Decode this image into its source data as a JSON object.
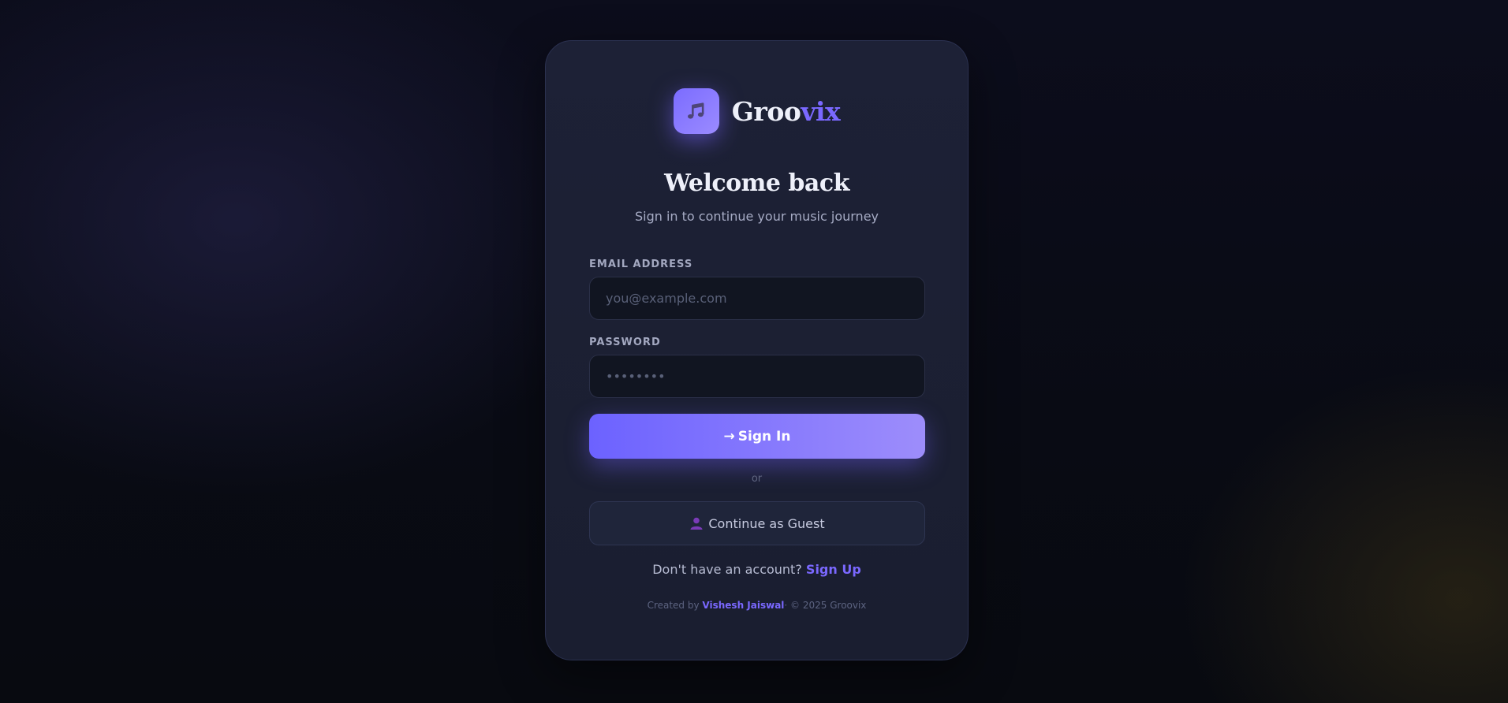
{
  "brand": {
    "name_main": "Groo",
    "name_accent": "vix",
    "logo_icon": "music-note-icon"
  },
  "heading": {
    "title": "Welcome back",
    "subtitle": "Sign in to continue your music journey"
  },
  "form": {
    "email": {
      "label": "EMAIL ADDRESS",
      "placeholder": "you@example.com",
      "value": ""
    },
    "password": {
      "label": "PASSWORD",
      "placeholder": "••••••••",
      "value": ""
    },
    "sign_in": {
      "icon": "→",
      "label": "Sign In"
    },
    "divider": "or",
    "guest": {
      "icon": "user-icon",
      "label": "Continue as Guest"
    }
  },
  "signup": {
    "prompt": "Don't have an account?",
    "link_label": "Sign Up"
  },
  "footer": {
    "created_by": "Created by",
    "author": "Vishesh Jaiswal",
    "copyright": "· © 2025 Groovix"
  },
  "colors": {
    "accent": "#7a68ff",
    "primary_gradient_start": "#6c62ff",
    "primary_gradient_end": "#9d8dfb",
    "card_background": "#1d2136",
    "input_background": "#111521"
  }
}
